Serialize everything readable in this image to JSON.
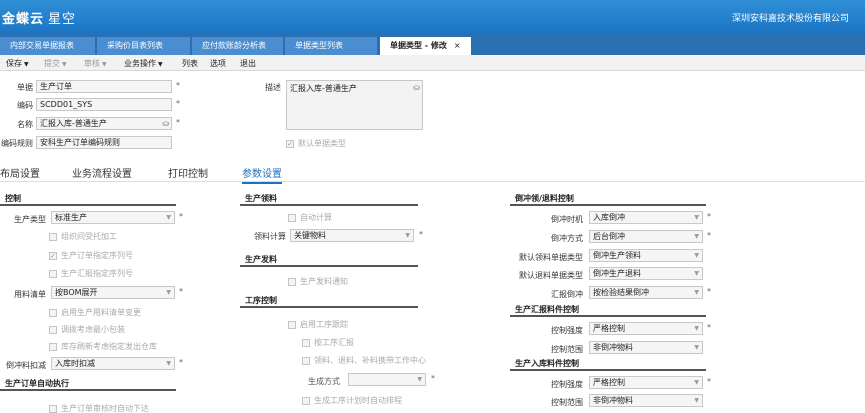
{
  "app": {
    "logo_main": "金蝶云",
    "logo_sub": "星空",
    "company": "深圳安科嘉技术股份有限公司"
  },
  "tabs": [
    {
      "label": "内部交易单据报表"
    },
    {
      "label": "采购价目表列表"
    },
    {
      "label": "应付款账龄分析表"
    },
    {
      "label": "单据类型列表"
    },
    {
      "label": "单据类型 - 修改",
      "close": "×"
    }
  ],
  "toolbar": {
    "save": "保存",
    "submit": "提交",
    "audit": "审核",
    "business": "业务操作",
    "list": "列表",
    "options": "选项",
    "exit": "退出"
  },
  "header": {
    "document_label": "单据",
    "document_value": "生产订单",
    "code_label": "编码",
    "code_value": "SCDD01_SYS",
    "name_label": "名称",
    "name_value": "汇报入库-普通生产",
    "rule_label": "编码规则",
    "rule_value": "安科生产订单编码规则",
    "desc_label": "描述",
    "desc_value": "汇报入库-普通生产",
    "default_type": "默认单据类型",
    "required_mark": "*"
  },
  "subtabs": [
    "布局设置",
    "业务流程设置",
    "打印控制",
    "参数设置"
  ],
  "left": {
    "sec_control": "控制",
    "prod_type_label": "生产类型",
    "prod_type_value": "标准生产",
    "chk_outsource": "组织间受托加工",
    "chk_seq": "生产订单指定序列号",
    "chk_report_seq": "生产汇报指定序列号",
    "bom_label": "用料清单",
    "bom_value": "按BOM展开",
    "chk_bom_change": "启用生产用料清单变更",
    "chk_min_pack": "调拨考虑最小包装",
    "chk_refresh_warehouse": "库存刷新考虑指定发出仓库",
    "deduct_label": "倒冲料扣减",
    "deduct_value": "入库时扣减",
    "sec_auto": "生产订单自动执行",
    "chk_auto_issue": "生产订单审核时自动下达"
  },
  "middle": {
    "sec_material": "生产领料",
    "chk_auto_calc": "自动计算",
    "calc_label": "领料计算",
    "calc_value": "关键物料",
    "sec_issue": "生产发料",
    "chk_issue_notice": "生产发料通知",
    "sec_process": "工序控制",
    "chk_process": "启用工序跟踪",
    "chk_process_report": "按工序汇报",
    "chk_process_material": "领料、退料、补料携带工作中心",
    "gen_label": "生成方式",
    "chk_gen_plan": "生成工序计划时自动排程"
  },
  "right": {
    "sec_backflush": "倒冲领/退料控制",
    "bf_time_label": "倒冲时机",
    "bf_time_value": "入库倒冲",
    "bf_mode_label": "倒冲方式",
    "bf_mode_value": "后台倒冲",
    "pick_type_label": "默认领料单据类型",
    "pick_type_value": "倒冲生产领料",
    "return_type_label": "默认退料单据类型",
    "return_type_value": "倒冲生产退料",
    "report_bf_label": "汇报倒冲",
    "report_bf_value": "按检验结果倒冲",
    "sec_report_material": "生产汇报料件控制",
    "ctrl_strength_label": "控制强度",
    "ctrl_strength_value": "严格控制",
    "ctrl_range_label": "控制范围",
    "ctrl_range_value": "非倒冲物料",
    "sec_stock_material": "生产入库料件控制",
    "ctrl_strength2_label": "控制强度",
    "ctrl_strength2_value": "严格控制",
    "ctrl_range2_label": "控制范围",
    "ctrl_range2_value": "非倒冲物料"
  }
}
